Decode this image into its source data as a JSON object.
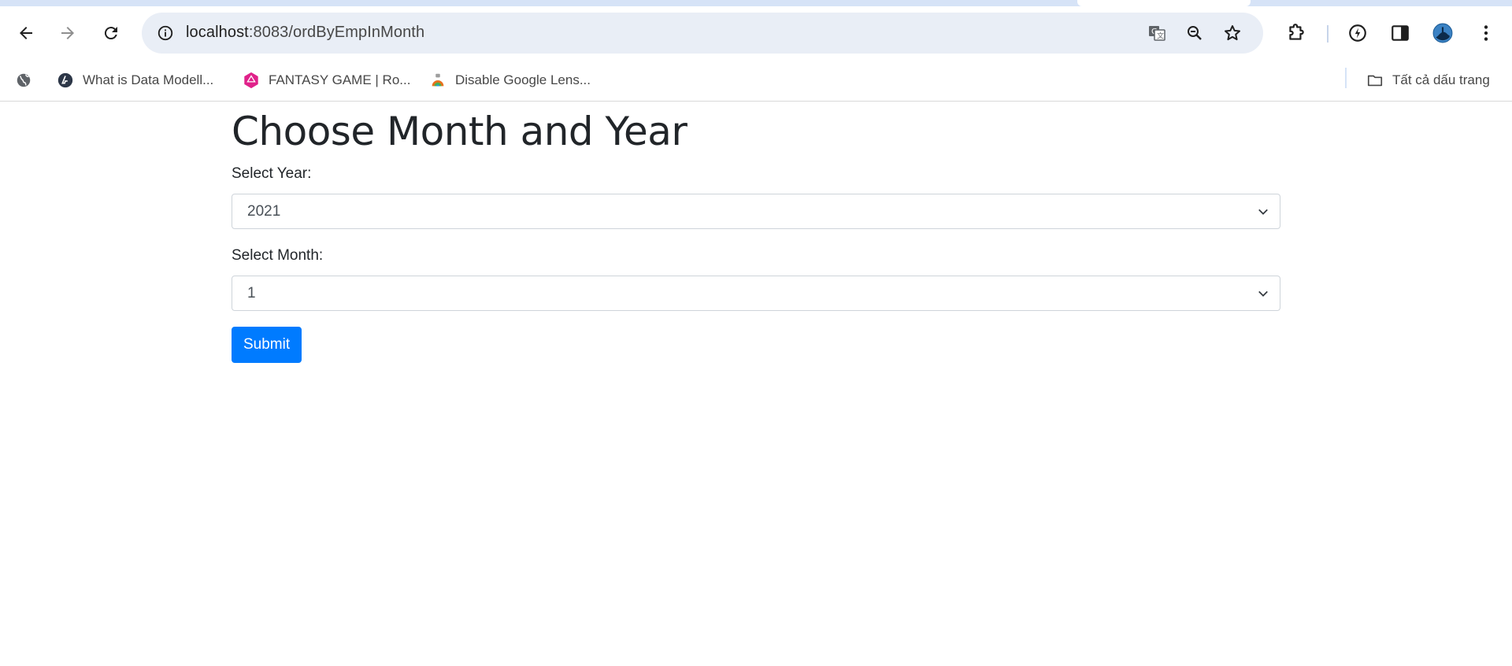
{
  "browser": {
    "url_host": "localhost",
    "url_path": ":8083/ordByEmpInMonth",
    "icons": [
      "back-icon",
      "forward-icon",
      "reload-icon",
      "site-info-icon",
      "translate-icon",
      "zoom-icon",
      "star-icon",
      "extensions-icon",
      "performance-icon",
      "side-panel-icon",
      "profile-avatar",
      "menu-icon"
    ]
  },
  "bookmarks": {
    "items": [
      {
        "label": "What is Data Modell...",
        "icon": "bookmark-datamodel-icon",
        "color": "#2d3748"
      },
      {
        "label": "FANTASY GAME | Ro...",
        "icon": "bookmark-fantasy-icon",
        "color": "#e0218a"
      },
      {
        "label": "Disable Google Lens...",
        "icon": "bookmark-lens-icon",
        "color": "#e8711c"
      }
    ],
    "all_bookmarks_label": "Tất cả dấu trang"
  },
  "page": {
    "title": "Choose Month and Year",
    "year_label": "Select Year:",
    "year_value": "2021",
    "month_label": "Select Month:",
    "month_value": "1",
    "submit_label": "Submit"
  },
  "colors": {
    "primary": "#007bff",
    "omnibox_bg": "#e9eef6",
    "text": "#212529"
  }
}
